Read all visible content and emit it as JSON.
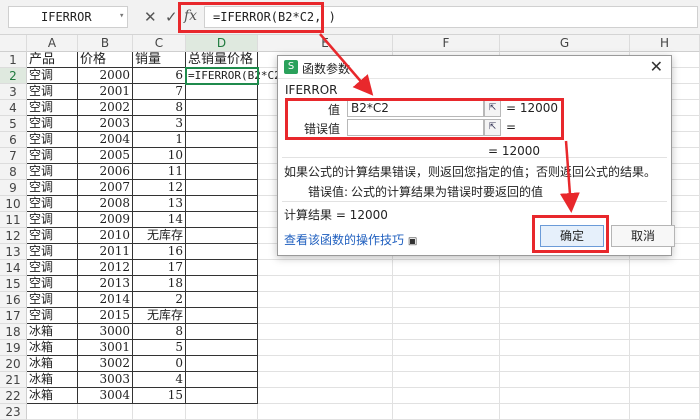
{
  "formula_bar": {
    "name_box": "IFERROR",
    "cancel_icon": "✕",
    "confirm_icon": "✓",
    "fx_label": "fx",
    "formula": "=IFERROR(B2*C2, )"
  },
  "sheet": {
    "columns": [
      "A",
      "B",
      "C",
      "D",
      "E",
      "F",
      "G",
      "H"
    ],
    "headers": {
      "A": "产品",
      "B": "价格",
      "C": "销量",
      "D": "总销量价格"
    },
    "rows": [
      {
        "n": "1"
      },
      {
        "n": "2",
        "a": "空调",
        "b": "2000",
        "c": "6",
        "d": "=IFERROR(B2*C2,"
      },
      {
        "n": "3",
        "a": "空调",
        "b": "2001",
        "c": "7"
      },
      {
        "n": "4",
        "a": "空调",
        "b": "2002",
        "c": "8"
      },
      {
        "n": "5",
        "a": "空调",
        "b": "2003",
        "c": "3"
      },
      {
        "n": "6",
        "a": "空调",
        "b": "2004",
        "c": "1"
      },
      {
        "n": "7",
        "a": "空调",
        "b": "2005",
        "c": "10"
      },
      {
        "n": "8",
        "a": "空调",
        "b": "2006",
        "c": "11"
      },
      {
        "n": "9",
        "a": "空调",
        "b": "2007",
        "c": "12"
      },
      {
        "n": "10",
        "a": "空调",
        "b": "2008",
        "c": "13"
      },
      {
        "n": "11",
        "a": "空调",
        "b": "2009",
        "c": "14"
      },
      {
        "n": "12",
        "a": "空调",
        "b": "2010",
        "c": "无库存"
      },
      {
        "n": "13",
        "a": "空调",
        "b": "2011",
        "c": "16"
      },
      {
        "n": "14",
        "a": "空调",
        "b": "2012",
        "c": "17"
      },
      {
        "n": "15",
        "a": "空调",
        "b": "2013",
        "c": "18"
      },
      {
        "n": "16",
        "a": "空调",
        "b": "2014",
        "c": "2"
      },
      {
        "n": "17",
        "a": "空调",
        "b": "2015",
        "c": "无库存"
      },
      {
        "n": "18",
        "a": "冰箱",
        "b": "3000",
        "c": "8"
      },
      {
        "n": "19",
        "a": "冰箱",
        "b": "3001",
        "c": "5"
      },
      {
        "n": "20",
        "a": "冰箱",
        "b": "3002",
        "c": "0"
      },
      {
        "n": "21",
        "a": "冰箱",
        "b": "3003",
        "c": "4"
      },
      {
        "n": "22",
        "a": "冰箱",
        "b": "3004",
        "c": "15"
      },
      {
        "n": "23"
      }
    ]
  },
  "dialog": {
    "logo": "S",
    "title": "函数参数",
    "close_icon": "✕",
    "function_name": "IFERROR",
    "arg1_label": "值",
    "arg1_value": "B2*C2",
    "arg1_result": "= 12000",
    "arg2_label": "错误值",
    "arg2_value": "",
    "arg2_result": "=",
    "overall_result": "= 12000",
    "description": "如果公式的计算结果错误，则返回您指定的值；否则返回公式的结果。",
    "param_desc_label": "错误值:",
    "param_desc": "公式的计算结果为错误时要返回的值",
    "calc_result": "计算结果 = 12000",
    "help_link": "查看该函数的操作技巧",
    "ok": "确定",
    "cancel": "取消"
  },
  "colors": {
    "highlight": "#e8282c",
    "active_cell": "#1f8a4c",
    "link": "#1f5fbf"
  }
}
